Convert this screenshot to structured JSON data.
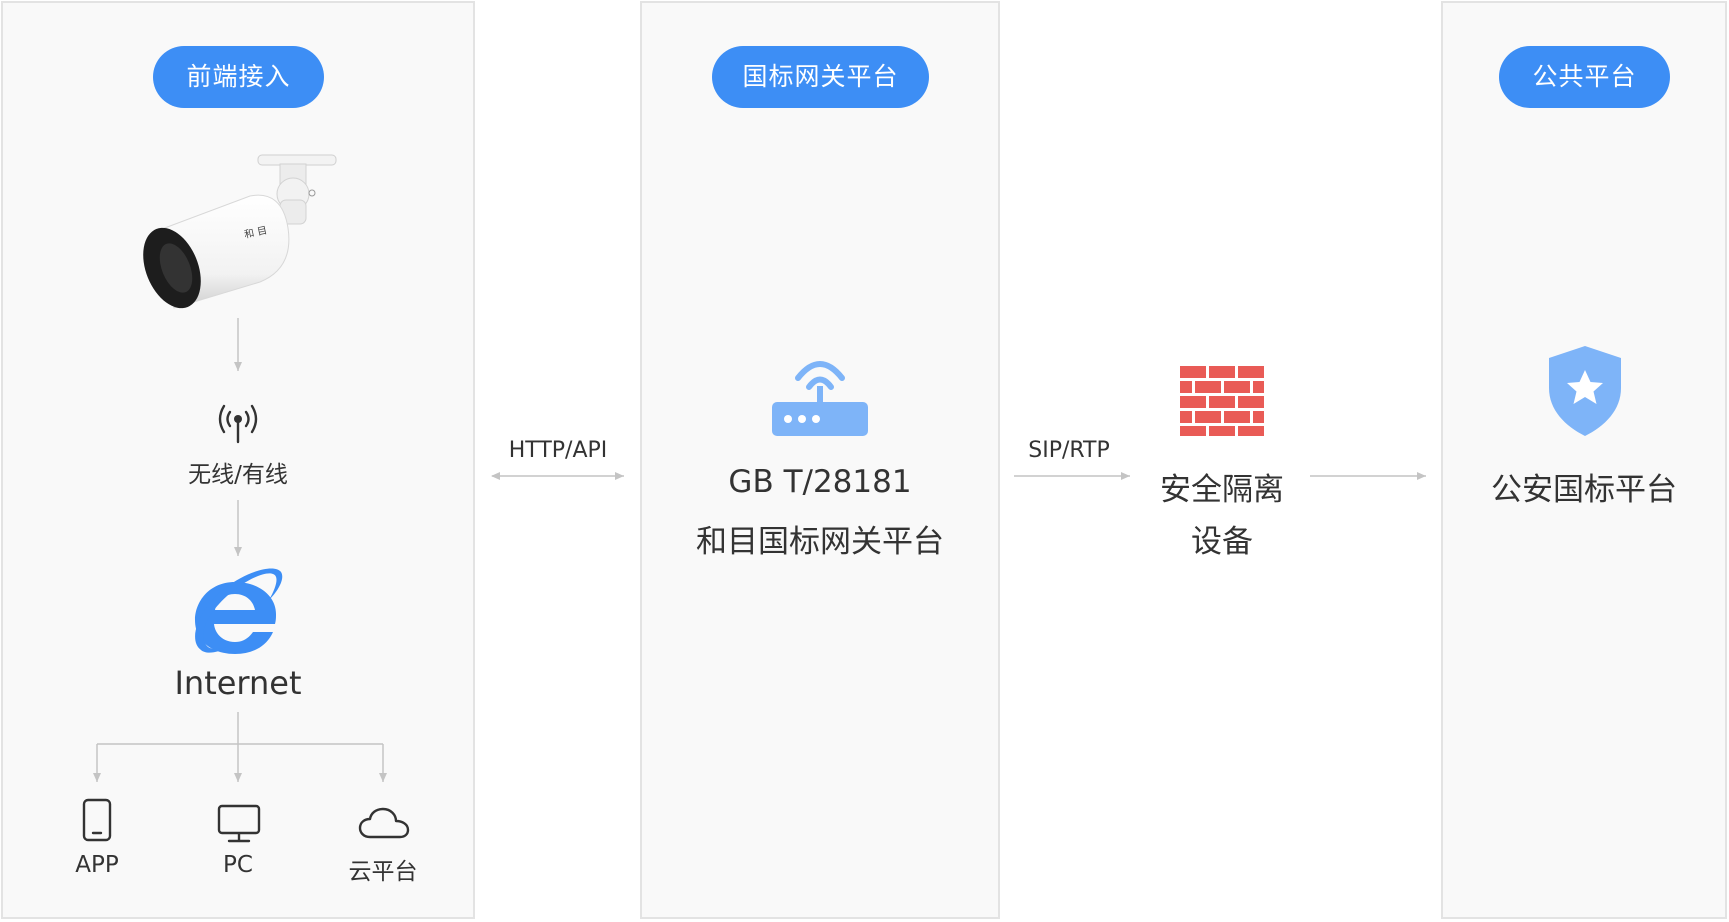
{
  "sections": {
    "front": {
      "title": "前端接入"
    },
    "gateway": {
      "title": "国标网关平台"
    },
    "public": {
      "title": "公共平台"
    }
  },
  "front": {
    "camera_icon": "bullet-camera",
    "wireless_icon": "antenna-signal-icon",
    "wireless_label": "无线/有线",
    "internet_icon": "internet-explorer-icon",
    "internet_label": "Internet",
    "clients": [
      {
        "icon": "phone-icon",
        "label": "APP"
      },
      {
        "icon": "monitor-icon",
        "label": "PC"
      },
      {
        "icon": "cloud-icon",
        "label": "云平台"
      }
    ]
  },
  "links": {
    "http": "HTTP/API",
    "sip": "SIP/RTP"
  },
  "gateway": {
    "icon": "router-icon",
    "line1": "GB T/28181",
    "line2": "和目国标网关平台"
  },
  "isolation": {
    "icon": "firewall-icon",
    "line1": "安全隔离",
    "line2": "设备"
  },
  "public": {
    "icon": "police-shield-icon",
    "label": "公安国标平台"
  },
  "colors": {
    "accent": "#3d8ef5",
    "icon_blue": "#7eb4f8",
    "firewall_red": "#e95b56",
    "arrow_gray": "#c4c4c4",
    "panel_bg": "#f9f9f9"
  }
}
